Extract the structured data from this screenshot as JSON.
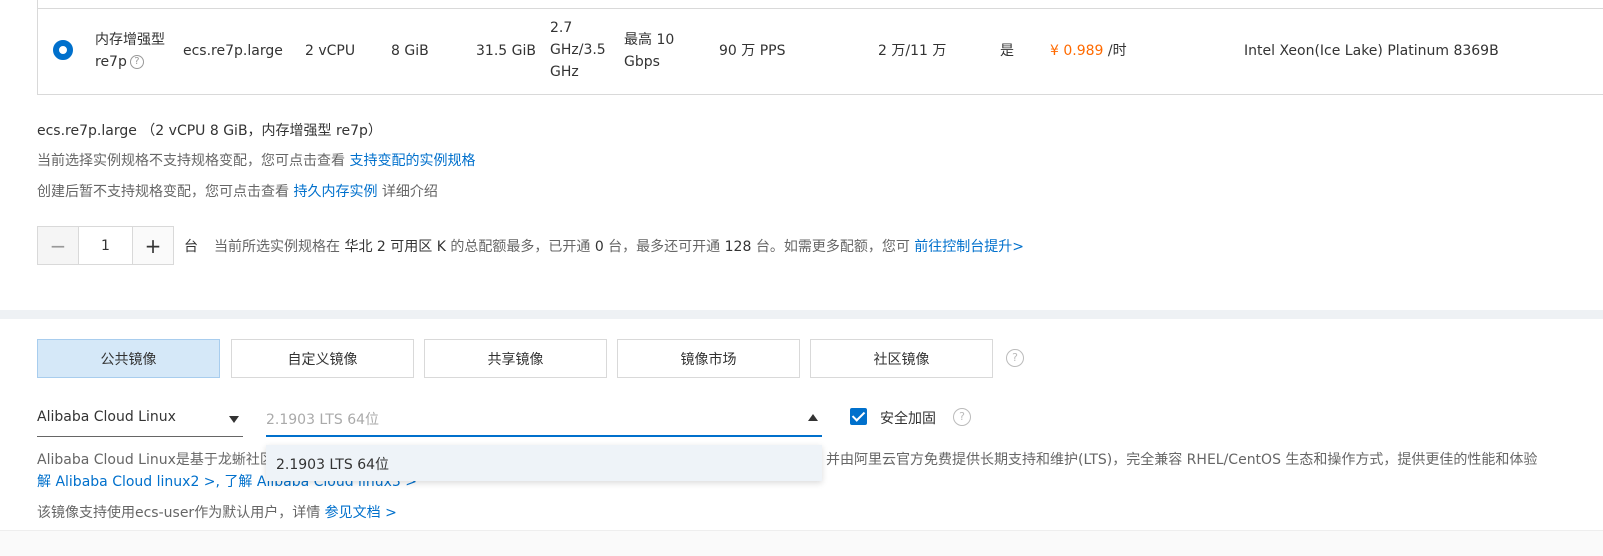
{
  "instance": {
    "family_line1": "内存增强型",
    "family_line2": "re7p",
    "help": "?",
    "spec": "ecs.re7p.large",
    "vcpu": "2 vCPU",
    "memory": "8 GiB",
    "bandwidth_mem": "31.5 GiB",
    "freq_l1": "2.7",
    "freq_l2": "GHz/3.5",
    "freq_l3": "GHz",
    "net_l1": "最高 10",
    "net_l2": "Gbps",
    "pps": "90 万 PPS",
    "connections": "2 万/11 万",
    "ipv6": "是",
    "price_value": "¥ 0.989",
    "price_unit": " /时",
    "cpu_model": "Intel Xeon(Ice Lake) Platinum 8369B"
  },
  "summary": {
    "spec": "ecs.re7p.large",
    "detail": "（2 vCPU 8 GiB，内存增强型 re7p）"
  },
  "notes": {
    "n1_text": "当前选择实例规格不支持规格变配，您可点击查看 ",
    "n1_link": "支持变配的实例规格",
    "n2_text": "创建后暂不支持规格变配，您可点击查看 ",
    "n2_link": "持久内存实例",
    "n2_suffix": " 详细介绍"
  },
  "stepper": {
    "minus": "−",
    "value": "1",
    "plus": "+",
    "unit": "台"
  },
  "quota": {
    "p1": "当前所选实例规格在 ",
    "region": "华北 2 可用区 K",
    "p2": " 的总配额最多，已开通 ",
    "opened": "0",
    "p3": " 台，最多还可开通 ",
    "remaining": "128",
    "p4": " 台。如需更多配额，您可 ",
    "link": "前往控制台提升>"
  },
  "image_tabs": [
    {
      "label": "公共镜像"
    },
    {
      "label": "自定义镜像"
    },
    {
      "label": "共享镜像"
    },
    {
      "label": "镜像市场"
    },
    {
      "label": "社区镜像"
    }
  ],
  "image": {
    "os": "Alibaba Cloud Linux",
    "version_placeholder": "2.1903 LTS 64位",
    "option": "2.1903 LTS 64位",
    "security_label": "安全加固",
    "desc_left": "Alibaba Cloud Linux是基于龙蜥社区",
    "desc_right": "，并由阿里云官方免费提供长期支持和维护(LTS)，完全兼容 RHEL/CentOS 生态和操作方式，提供更佳的性能和体验",
    "desc2": "解 Alibaba Cloud linux2 >, 了解 Alibaba Cloud linux3 >",
    "user_note": "该镜像支持使用ecs-user作为默认用户，详情 ",
    "user_note_link": "参见文档 >"
  },
  "colors": {
    "link": "#0070cc",
    "price": "#ff6a00",
    "active_tab": "#d5e8f8"
  }
}
